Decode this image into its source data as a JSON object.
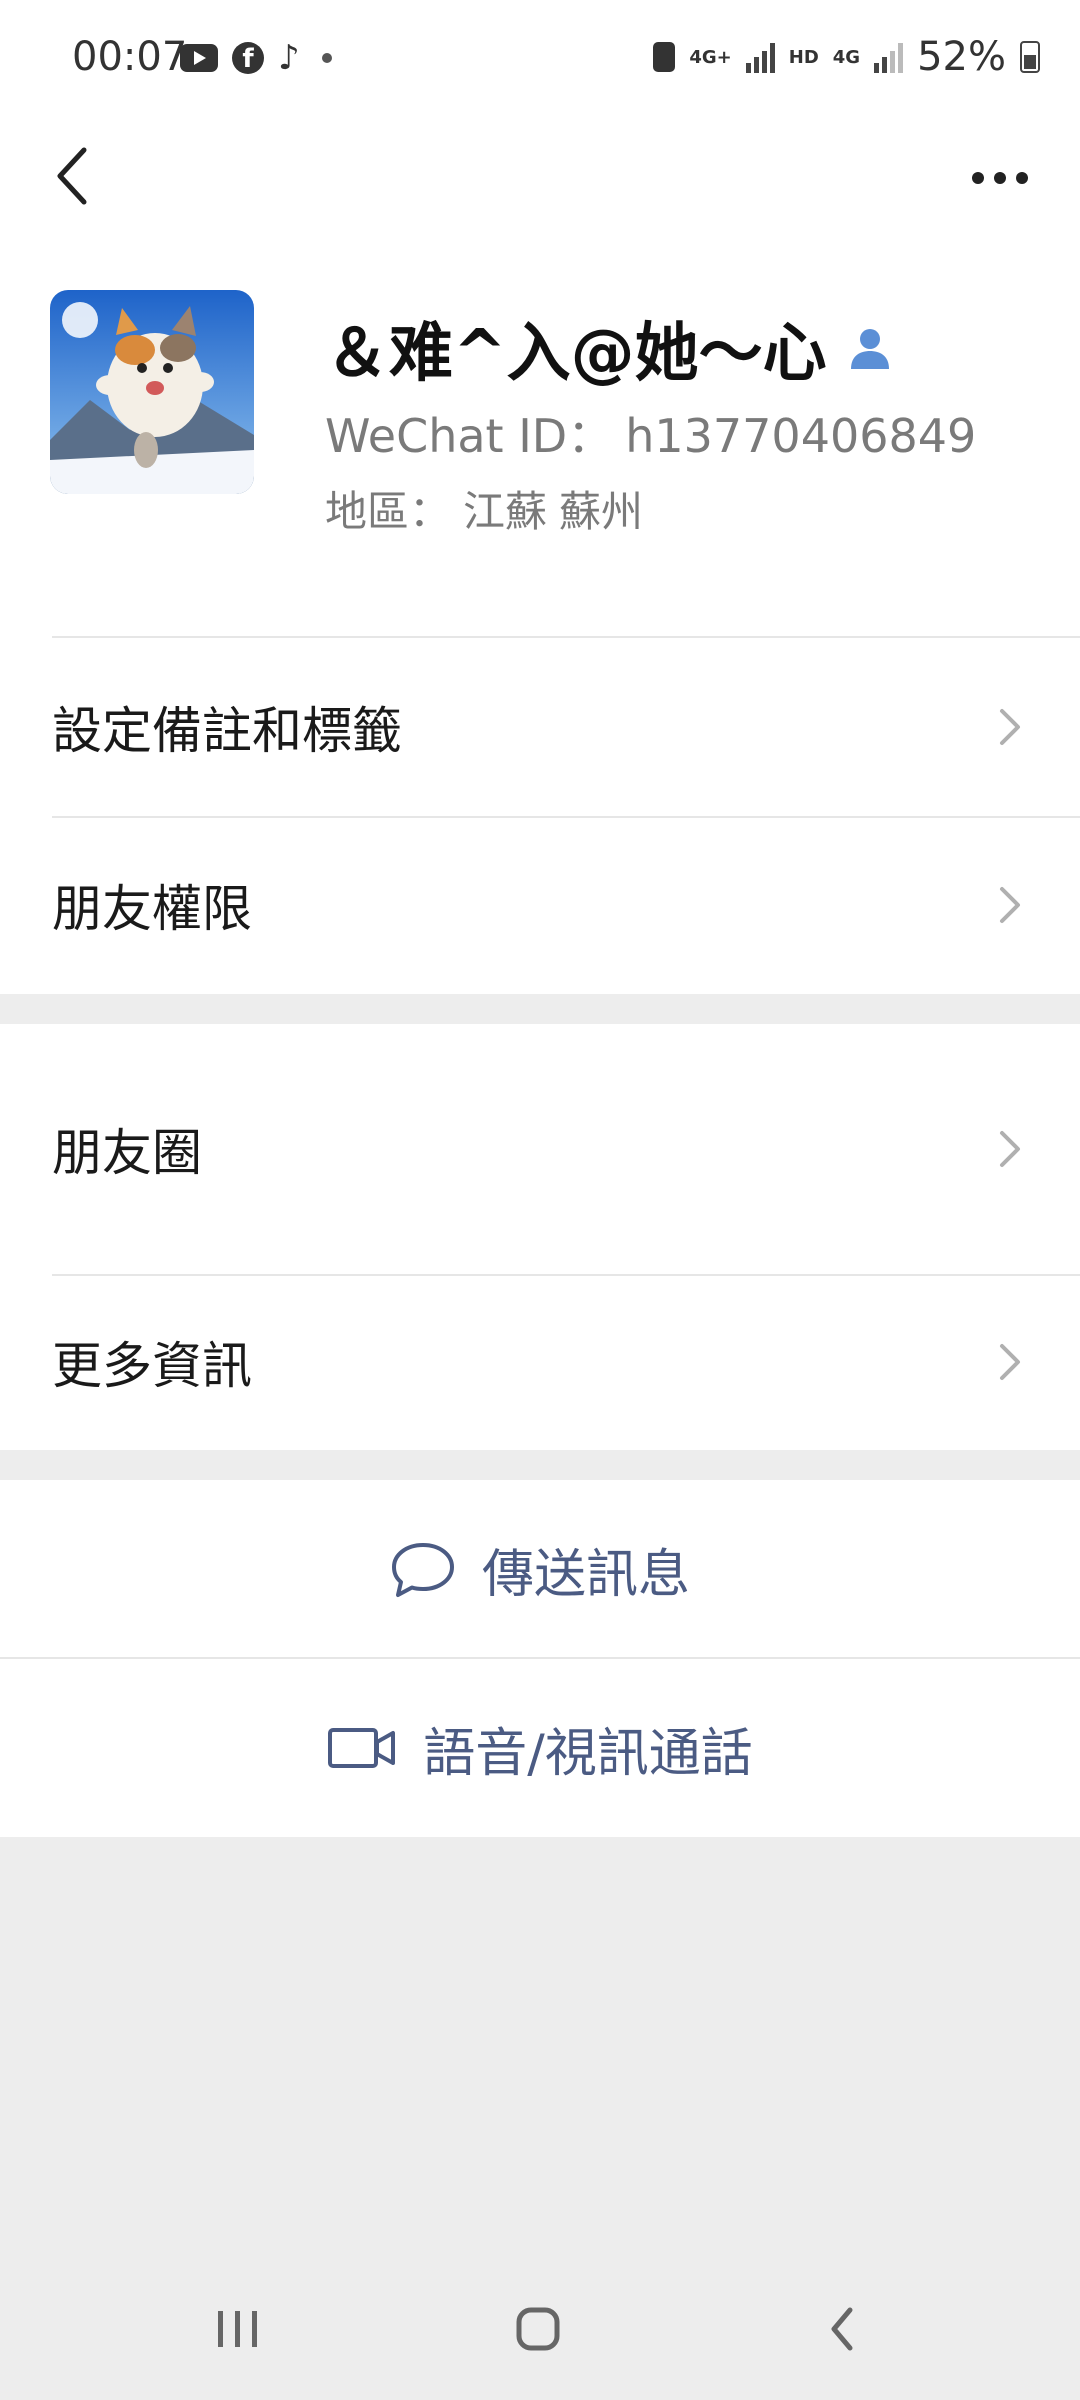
{
  "status_bar": {
    "time": "00:07",
    "network_1": "4G+",
    "network_2": "HD",
    "network_3": "4G",
    "battery": "52%"
  },
  "nav": {
    "back_icon": "chevron-left-icon",
    "more_icon": "more-dots-icon"
  },
  "profile": {
    "nickname": "＆难^入@她～心",
    "wechat_id_label": "WeChat ID：",
    "wechat_id": "h13770406849",
    "region_label": "地區：",
    "region_province": "江蘇",
    "region_city": "蘇州"
  },
  "menu_group_1": [
    {
      "label": "設定備註和標籤"
    },
    {
      "label": "朋友權限"
    }
  ],
  "menu_group_2": [
    {
      "label": "朋友圈"
    },
    {
      "label": "更多資訊"
    }
  ],
  "actions": {
    "send_message": "傳送訊息",
    "voice_video_call": "語音/視訊通話"
  },
  "colors": {
    "accent_text": "#4b5b83",
    "background": "#ededed",
    "verified_icon": "#5b8fd6"
  }
}
